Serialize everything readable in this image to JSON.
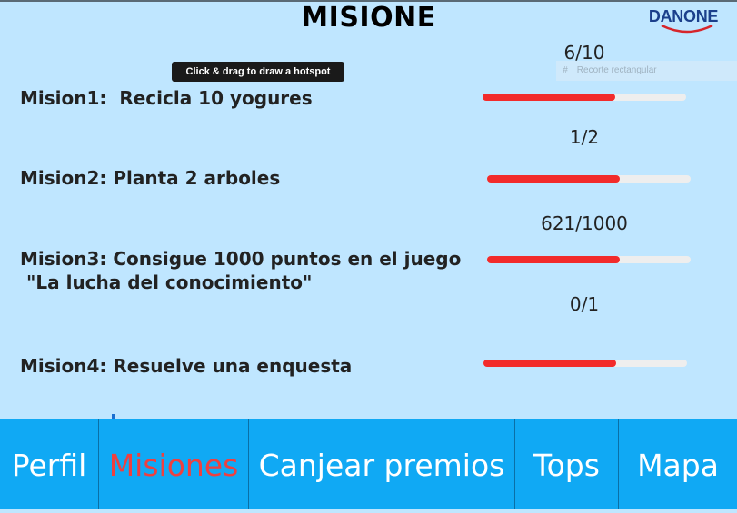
{
  "page": {
    "title": "MISIONE"
  },
  "brand": {
    "name": "DANONE",
    "accent": "#1b3f8b"
  },
  "tooltip": {
    "text": "Click & drag to draw a hotspot"
  },
  "ghost_menu": {
    "icon": "#",
    "label": "Recorte rectangular"
  },
  "missions": [
    {
      "label": "Mision1:  Recicla 10 yogures",
      "progress_text": "6/10",
      "fill_fraction": 0.65
    },
    {
      "label": "Mision2: Planta 2 arboles",
      "progress_text": "1/2",
      "fill_fraction": 0.65
    },
    {
      "label": "Mision3: Consigue 1000 puntos en el juego\n \"La lucha del conocimiento\"",
      "progress_text": "621/1000",
      "fill_fraction": 0.65
    },
    {
      "label": "Mision4: Resuelve una enquesta",
      "progress_text": "0/1",
      "fill_fraction": 0.65
    }
  ],
  "nav": {
    "items": [
      {
        "label": "Perfil",
        "active": false
      },
      {
        "label": "Misiones",
        "active": true
      },
      {
        "label": "Canjear premios",
        "active": false
      },
      {
        "label": "Tops",
        "active": false
      },
      {
        "label": "Mapa",
        "active": false
      }
    ]
  },
  "colors": {
    "background": "#bfe6ff",
    "nav": "#10a9f4",
    "progress": "#f22b2b",
    "active_nav": "#ee4040"
  }
}
